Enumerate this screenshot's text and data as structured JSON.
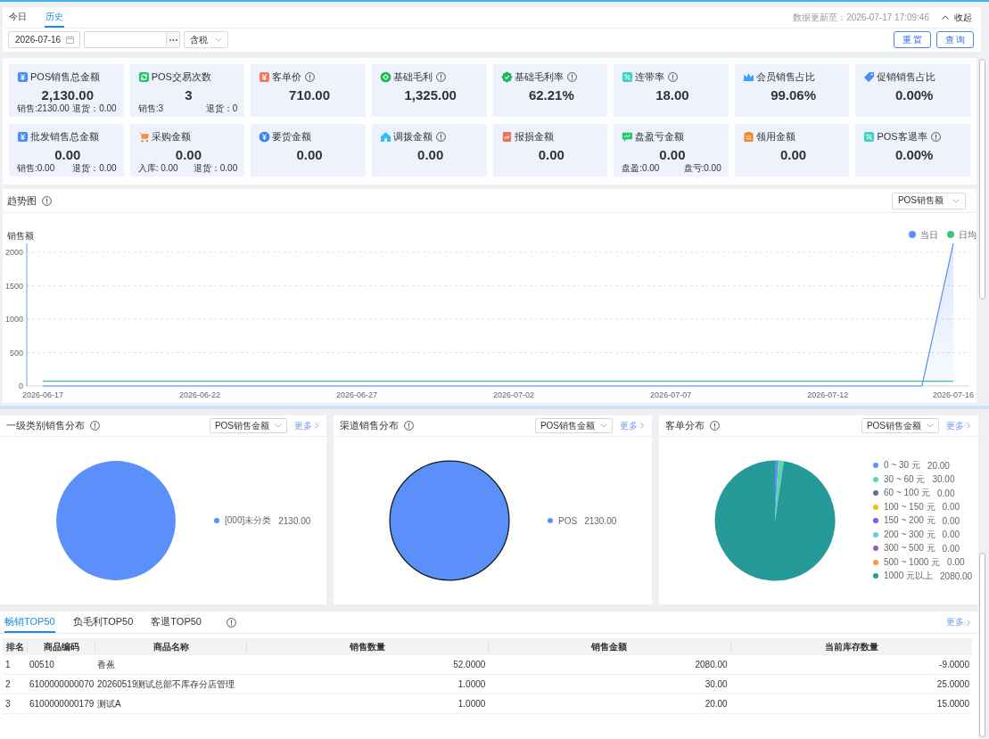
{
  "top_bar": {
    "tabs": [
      {
        "label": "今日",
        "selected": false
      },
      {
        "label": "历史",
        "selected": true
      }
    ],
    "updated": "数据更新至：2026-07-17 17:09:46",
    "collapse": "收起"
  },
  "filters": {
    "date": "2026-07-16",
    "tax": "含税",
    "buttons": [
      "重 置",
      "查 询"
    ]
  },
  "cards": [
    {
      "title": "POS销售总金额",
      "color": "#4e8cf7",
      "info": false,
      "value": "2,130.00",
      "details": [
        "销售:2130.00",
        "退货：0.00"
      ]
    },
    {
      "title": "POS交易次数",
      "color": "#26c76a",
      "info": false,
      "value": "3",
      "details": [
        "销售:3",
        "退货：0"
      ]
    },
    {
      "title": "客单价",
      "color": "#f07b5a",
      "info": true,
      "value": "710.00"
    },
    {
      "title": "基础毛利",
      "color": "#19b955",
      "info": true,
      "value": "1,325.00"
    },
    {
      "title": "基础毛利率",
      "color": "#1fb85a",
      "info": true,
      "value": "62.21%"
    },
    {
      "title": "连带率",
      "color": "#3dd1bf",
      "info": true,
      "value": "18.00"
    },
    {
      "title": "会员销售占比",
      "color": "#35a6f3",
      "info": false,
      "value": "99.06%"
    },
    {
      "title": "促销销售占比",
      "color": "#4d8af5",
      "info": false,
      "value": "0.00%"
    },
    {
      "title": "批发销售总金额",
      "color": "#4e8cf7",
      "info": false,
      "value": "0.00",
      "details": [
        "销售:0.00",
        "退货：0.00"
      ]
    },
    {
      "title": "采购金额",
      "color": "#f68c35",
      "info": false,
      "value": "0.00",
      "details": [
        "入库: 0.00",
        "退货：0.00"
      ]
    },
    {
      "title": "要货金额",
      "color": "#3b82f6",
      "info": false,
      "value": "0.00"
    },
    {
      "title": "调拨金额",
      "color": "#38bdf2",
      "info": true,
      "value": "0.00"
    },
    {
      "title": "报损金额",
      "color": "#ee7259",
      "info": false,
      "value": "0.00"
    },
    {
      "title": "盘盈亏金额",
      "color": "#25c96b",
      "info": false,
      "value": "0.00",
      "details": [
        "盘盈:0.00",
        "盘亏:0.00"
      ]
    },
    {
      "title": "领用金额",
      "color": "#f5892c",
      "info": false,
      "value": "0.00"
    },
    {
      "title": "POS客退率",
      "color": "#3dd1bf",
      "info": true,
      "value": "0.00%"
    }
  ],
  "trend": {
    "title": "趋势图",
    "metric": "POS销售额",
    "chart_data": {
      "type": "area",
      "stacked": false,
      "grid": true,
      "legend": "top-right",
      "ylabel": "销售额",
      "categories": [
        "2026-06-17",
        null,
        null,
        null,
        null,
        "2026-06-22",
        null,
        null,
        null,
        null,
        "2026-06-27",
        null,
        null,
        null,
        null,
        "2026-07-02",
        null,
        null,
        null,
        null,
        "2026-07-07",
        null,
        null,
        null,
        null,
        "2026-07-12",
        null,
        null,
        null,
        "2026-07-16"
      ],
      "series": [
        {
          "name": "当日",
          "type": "area",
          "color": "#5b8ff9",
          "values": [
            0,
            0,
            0,
            0,
            0,
            0,
            0,
            0,
            0,
            0,
            0,
            0,
            0,
            0,
            0,
            0,
            0,
            0,
            0,
            0,
            0,
            0,
            0,
            0,
            0,
            0,
            0,
            0,
            0,
            2130
          ]
        },
        {
          "name": "日均",
          "type": "line",
          "color": "#3cc47f",
          "values": [
            71,
            71,
            71,
            71,
            71,
            71,
            71,
            71,
            71,
            71,
            71,
            71,
            71,
            71,
            71,
            71,
            71,
            71,
            71,
            71,
            71,
            71,
            71,
            71,
            71,
            71,
            71,
            71,
            71,
            71
          ]
        }
      ],
      "ylim": [
        0,
        2130
      ],
      "yticks": [
        0,
        500,
        1000,
        1500,
        2000
      ]
    }
  },
  "distributions": [
    {
      "title": "一级类别销售分布",
      "metric": "POS销售金额",
      "more": "更多",
      "pie_outline": false,
      "slices": [
        {
          "value": "2130.00",
          "color": "#5b8ff9"
        }
      ],
      "chart_data": {
        "type": "pie",
        "categories": [
          "[000]未分类"
        ],
        "values": [
          100
        ]
      }
    },
    {
      "title": "渠道销售分布",
      "metric": "POS销售金额",
      "more": "更多",
      "pie_outline": true,
      "slices": [
        {
          "value": "2130.00",
          "color": "#5b8ff9"
        }
      ],
      "chart_data": {
        "type": "pie",
        "categories": [
          "POS"
        ],
        "values": [
          100
        ]
      }
    },
    {
      "title": "客单分布",
      "metric": "POS销售金额",
      "more": "更多",
      "pie_outline": false,
      "slices": [
        {
          "value": "20.00",
          "color": "#5b8ff9"
        },
        {
          "value": "30.00",
          "color": "#5ad8a6"
        },
        {
          "value": "0.00",
          "color": "#5d7092"
        },
        {
          "value": "0.00",
          "color": "#f6bd16"
        },
        {
          "value": "0.00",
          "color": "#6f5ef9"
        },
        {
          "value": "0.00",
          "color": "#6dc8ec"
        },
        {
          "value": "0.00",
          "color": "#945fb9"
        },
        {
          "value": "0.00",
          "color": "#ff9845"
        },
        {
          "value": "2080.00",
          "color": "#269a99"
        }
      ],
      "chart_data": {
        "type": "pie",
        "categories": [
          "0 ~ 30 元",
          "30 ~ 60 元",
          "60 ~ 100 元",
          "100 ~ 150 元",
          "150 ~ 200 元",
          "200 ~ 300 元",
          "300 ~ 500 元",
          "500 ~ 1000 元",
          "1000 元以上"
        ],
        "values": [
          20,
          30,
          0,
          0,
          0,
          0,
          0,
          0,
          2080
        ]
      }
    }
  ],
  "top_table": {
    "tabs": [
      {
        "label": "畅销TOP50",
        "selected": true
      },
      {
        "label": "负毛利TOP50",
        "selected": false
      },
      {
        "label": "客退TOP50",
        "selected": false
      }
    ],
    "more": "更多",
    "columns": [
      "排名",
      "商品编码",
      "商品名称",
      "销售数量",
      "销售金额",
      "当前库存数量"
    ],
    "rows": [
      [
        "1",
        "00510",
        "香蕉",
        "52.0000",
        "2080.00",
        "-9.0000"
      ],
      [
        "2",
        "6100000000070",
        "20260519测试总部不库存分店管理",
        "1.0000",
        "30.00",
        "25.0000"
      ],
      [
        "3",
        "6100000000179",
        "测试A",
        "1.0000",
        "20.00",
        "15.0000"
      ]
    ]
  }
}
